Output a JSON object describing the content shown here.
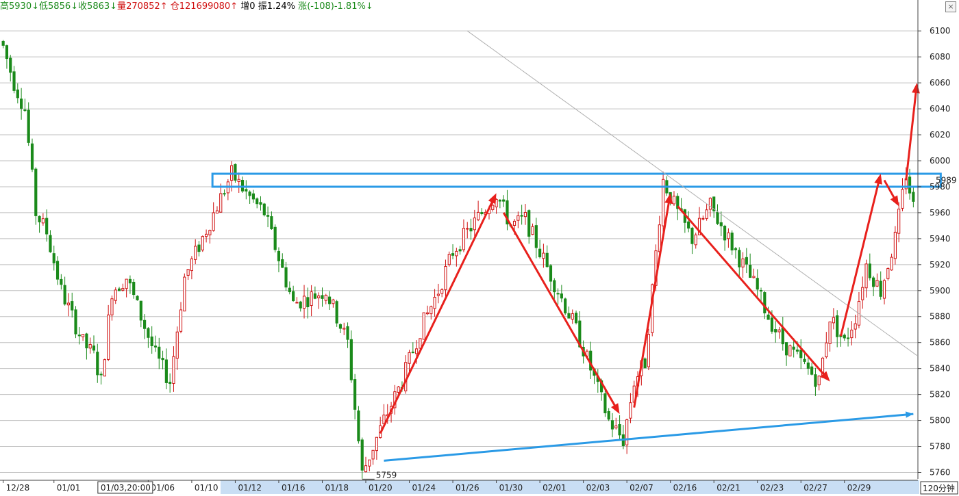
{
  "info_bar": {
    "high_label": "高",
    "high": "5930",
    "high_arrow": "↓",
    "low_label": "低",
    "low": "5856",
    "low_arrow": "↓",
    "close_label": "收",
    "close": "5863",
    "close_arrow": "↓",
    "volume_label": "量",
    "volume": "270852",
    "volume_arrow": "↑",
    "oi_label": "仓",
    "oi": "121699080",
    "oi_arrow": "↑",
    "inc_label": "增",
    "inc": "0",
    "amp_label": "振",
    "amp": "1.24%",
    "chg_label": "涨",
    "chg": "(-108)-1.81%",
    "chg_arrow": "↓"
  },
  "close_button": "×",
  "colors": {
    "up": "#d01010",
    "down": "#1a8a1a",
    "grid": "#bfbfbf",
    "blue_annotation": "#2a9ae6",
    "red_annotation": "#e8201c",
    "timeline_highlight": "#c9def4"
  },
  "chart_data": {
    "type": "candlestick",
    "period_label": "120分钟",
    "last_price_label": "5989",
    "low_marker_label": "5759",
    "crosshair_time_label": "01/03,20:00",
    "ylim": [
      5755,
      6108
    ],
    "y_ticks": [
      5760,
      5780,
      5800,
      5820,
      5840,
      5860,
      5880,
      5900,
      5920,
      5940,
      5960,
      5980,
      6000,
      6020,
      6040,
      6060,
      6080,
      6100
    ],
    "x_tick_labels": [
      "12/28",
      "01/01",
      "01/03,20:00",
      "01/06",
      "01/10",
      "01/12",
      "01/16",
      "01/18",
      "01/20",
      "01/24",
      "01/26",
      "01/30",
      "02/01",
      "02/03",
      "02/07",
      "02/16",
      "02/21",
      "02/23",
      "02/27",
      "02/29"
    ],
    "x_tick_index": [
      0,
      14,
      28,
      40,
      52,
      64,
      76,
      88,
      100,
      112,
      124,
      136,
      148,
      160,
      172,
      184,
      196,
      208,
      220,
      232
    ],
    "key_prices": [
      6088,
      6060,
      6040,
      5960,
      5945,
      5900,
      5880,
      5860,
      5850,
      5830,
      5900,
      5910,
      5880,
      5850,
      5830,
      5910,
      5990,
      5975,
      5960,
      5890,
      5900,
      5880,
      5860,
      5759,
      5800,
      5830,
      5870,
      5900,
      5930,
      5960,
      5975,
      5950,
      5955,
      5930,
      5900,
      5870,
      5840,
      5800,
      5785,
      5830,
      5845,
      5985,
      5960,
      5940,
      5965,
      5940,
      5920,
      5900,
      5880,
      5860,
      5830,
      5880,
      5860,
      5880,
      5920,
      5900,
      5940,
      5990,
      5965
    ],
    "key_index": [
      0,
      3,
      6,
      9,
      12,
      16,
      19,
      22,
      25,
      27,
      30,
      34,
      38,
      42,
      46,
      50,
      63,
      67,
      72,
      80,
      89,
      92,
      95,
      99,
      105,
      110,
      115,
      120,
      124,
      132,
      136,
      140,
      144,
      148,
      153,
      158,
      162,
      167,
      171,
      174,
      177,
      182,
      186,
      190,
      195,
      200,
      204,
      208,
      211,
      215,
      225,
      228,
      232,
      235,
      238,
      242,
      246,
      249,
      251
    ],
    "candle_count": 252,
    "annotations": {
      "resistance_box_price": [
        5980,
        5990
      ],
      "support_line": [
        {
          "i": 105,
          "p": 5769
        },
        {
          "i": 251,
          "p": 5805
        }
      ],
      "downtrend_line": [
        {
          "i": 128,
          "p": 6100
        },
        {
          "i": 252,
          "p": 5850
        }
      ],
      "red_arrows": [
        {
          "from": {
            "i": 104,
            "p": 5790
          },
          "to": {
            "i": 136,
            "p": 5975
          }
        },
        {
          "from": {
            "i": 138,
            "p": 5960
          },
          "to": {
            "i": 170,
            "p": 5805
          }
        },
        {
          "from": {
            "i": 174,
            "p": 5810
          },
          "to": {
            "i": 184,
            "p": 5975
          }
        },
        {
          "from": {
            "i": 186,
            "p": 5965
          },
          "to": {
            "i": 228,
            "p": 5830
          }
        },
        {
          "from": {
            "i": 231,
            "p": 5865
          },
          "to": {
            "i": 242,
            "p": 5990
          }
        },
        {
          "from": {
            "i": 243,
            "p": 5985
          },
          "to": {
            "i": 247,
            "p": 5965
          }
        },
        {
          "from": {
            "i": 249,
            "p": 5985
          },
          "to": {
            "i": 252,
            "p": 6060
          }
        }
      ]
    }
  }
}
